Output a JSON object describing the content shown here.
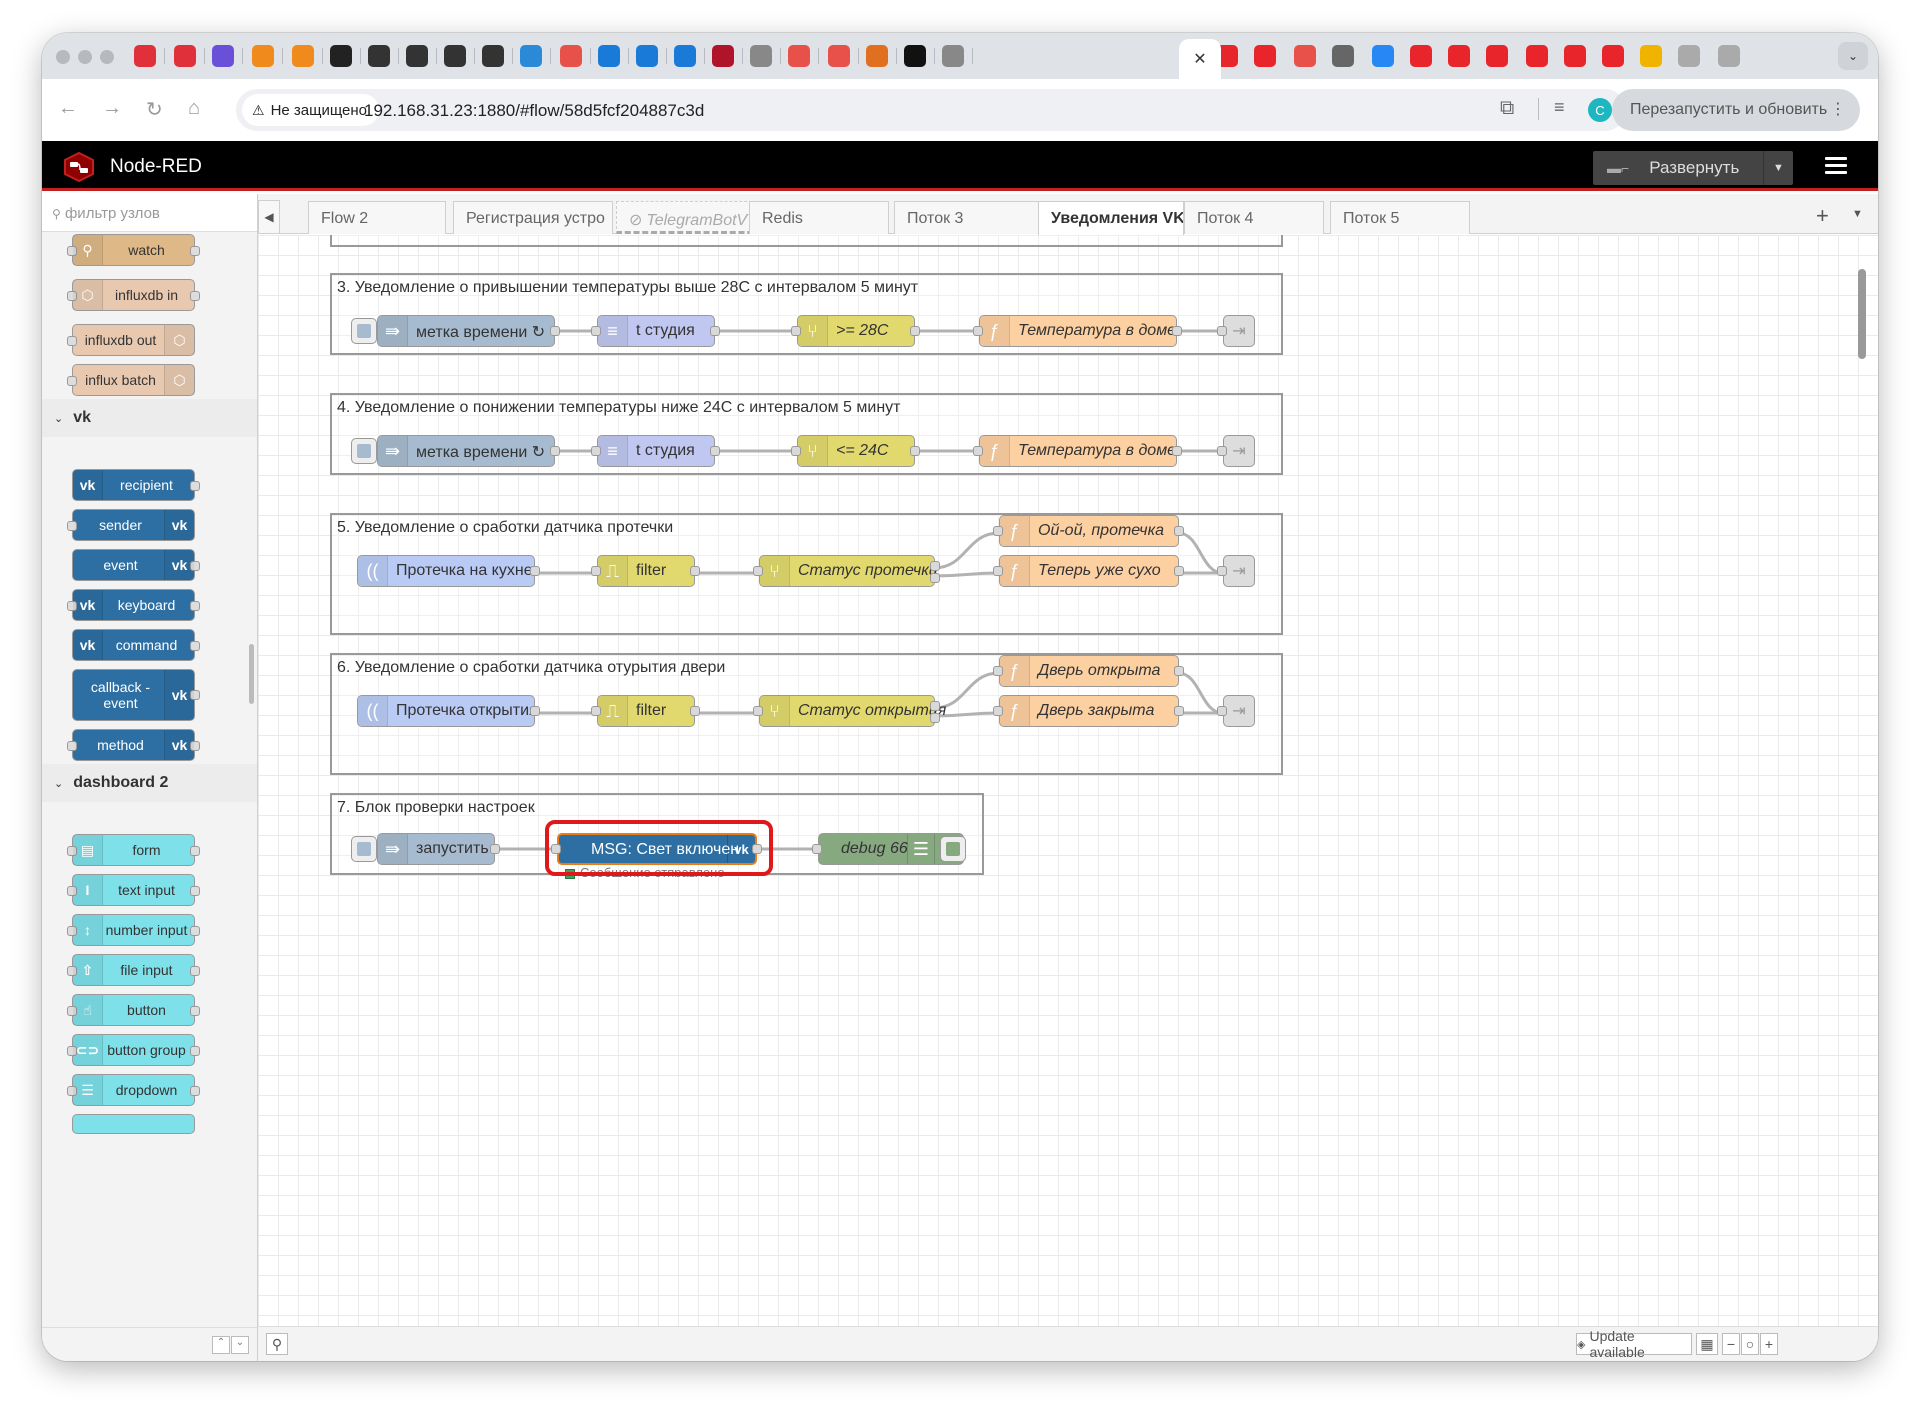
{
  "browser": {
    "security_label": "Не защищено",
    "url": "192.168.31.23:1880/#flow/58d5fcf204887c3d",
    "relaunch_label": "Перезапустить и обновить",
    "profile_initial": "C"
  },
  "app": {
    "title": "Node-RED",
    "deploy_label": "Развернуть"
  },
  "palette": {
    "filter_placeholder": "фильтр узлов",
    "top_nodes": [
      "watch",
      "influxdb in",
      "influxdb out",
      "influx batch"
    ],
    "category_vk": "vk",
    "vk_nodes": [
      "recipient",
      "sender",
      "event",
      "keyboard",
      "command",
      "callback -",
      "event",
      "method"
    ],
    "category_dashboard": "dashboard 2",
    "dashboard_nodes": [
      "form",
      "text input",
      "number input",
      "file input",
      "button",
      "button group",
      "dropdown"
    ]
  },
  "workspace_tabs": [
    "Flow 2",
    "Регистрация устро",
    "TelegramBotVVS",
    "Redis",
    "Поток 3",
    "Уведомления VK",
    "Поток 4",
    "Поток 5"
  ],
  "groups": [
    {
      "label": "3. Уведомление о привышении температуры выше 28С с интервалом 5 минут",
      "nodes": [
        "метка времени ↻",
        "t студия",
        ">= 28C",
        "Температура в доме"
      ]
    },
    {
      "label": "4. Уведомление о понижении температуры ниже 24С с интервалом 5 минут",
      "nodes": [
        "метка времени ↻",
        "t студия",
        "<= 24C",
        "Температура в доме"
      ]
    },
    {
      "label": "5. Уведомление о сработки датчика протечки",
      "nodes": [
        "Протечка на кухне",
        "filter",
        "Статус протечки",
        "Ой-ой, протечка",
        "Теперь уже сухо"
      ]
    },
    {
      "label": "6. Уведомление о сработки датчика отурытия двери",
      "nodes": [
        "Протечка открытия",
        "filter",
        "Статус открытия",
        "Дверь открыта",
        "Дверь закрыта"
      ]
    },
    {
      "label": "7. Блок проверки настроек",
      "nodes": [
        "запустить",
        "MSG: Свет включен",
        "debug 66"
      ],
      "status": "Сообщение отправлено"
    }
  ],
  "footer": {
    "update_label": "Update available"
  },
  "colors": {
    "inject": "#a6bbcf",
    "function": "#fdd0a2",
    "switch": "#e2d96e",
    "vk": "#2d6fa3",
    "debug": "#87a980",
    "dashboard": "#7ee0e8",
    "highlight": "#e0171b"
  }
}
